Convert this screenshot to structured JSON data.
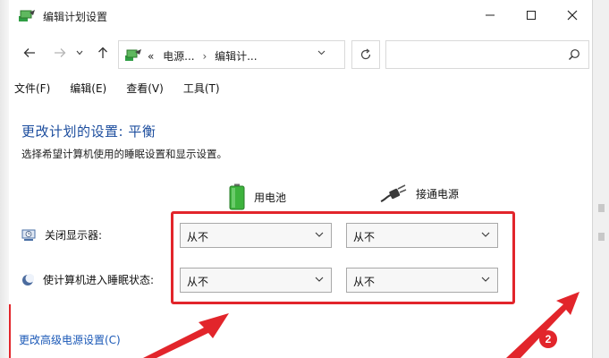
{
  "window": {
    "title": "编辑计划设置"
  },
  "address": {
    "crumbs": [
      "«",
      "电源...",
      "›",
      "编辑计..."
    ]
  },
  "search": {
    "placeholder": ""
  },
  "menu": {
    "items": [
      "文件(F)",
      "编辑(E)",
      "查看(V)",
      "工具(T)"
    ]
  },
  "content": {
    "title": "更改计划的设置: 平衡",
    "subtitle": "选择希望计算机使用的睡眠设置和显示设置。",
    "columns": {
      "battery": "用电池",
      "plugged": "接通电源"
    },
    "rows": [
      {
        "label": "关闭显示器:",
        "battery_value": "从不",
        "plugged_value": "从不"
      },
      {
        "label": "使计算机进入睡眠状态:",
        "battery_value": "从不",
        "plugged_value": "从不"
      }
    ],
    "advanced_link": "更改高级电源设置(C)"
  },
  "annotation": {
    "badge": "2"
  },
  "colors": {
    "title_blue": "#1c4d9e",
    "link_blue": "#1b59b7",
    "highlight_red": "#e2252b"
  }
}
